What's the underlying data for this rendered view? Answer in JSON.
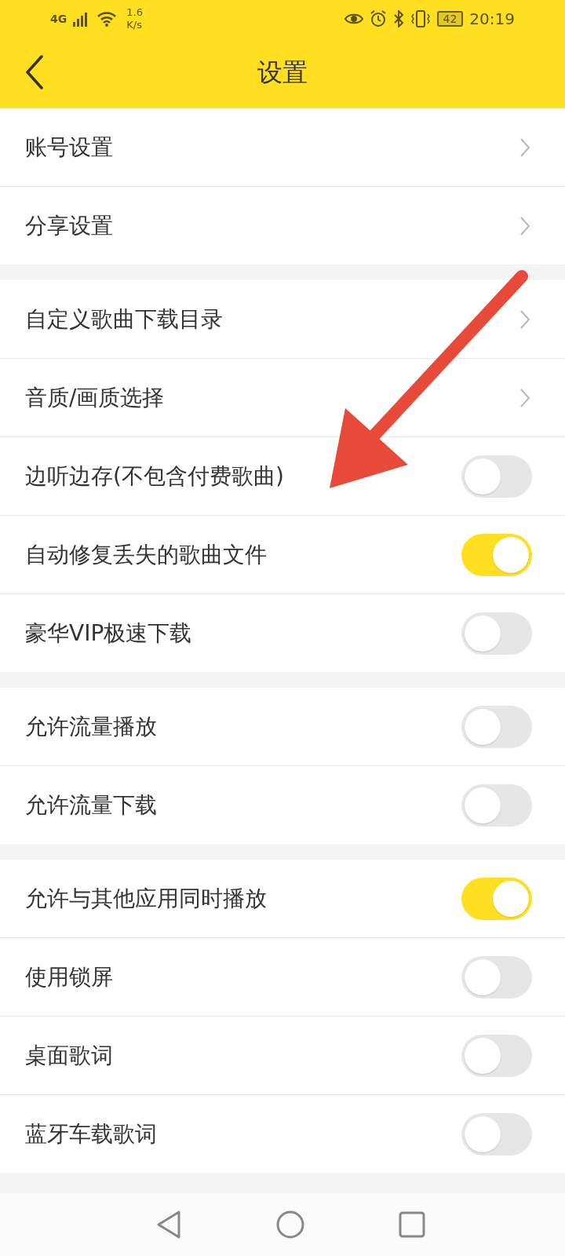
{
  "status_bar": {
    "network": "4G",
    "speed_value": "1.6",
    "speed_unit": "K/s",
    "battery": "42",
    "time": "20:19"
  },
  "header": {
    "title": "设置"
  },
  "sections": [
    {
      "items": [
        {
          "label": "账号设置",
          "kind": "link"
        },
        {
          "label": "分享设置",
          "kind": "link"
        }
      ]
    },
    {
      "items": [
        {
          "label": "自定义歌曲下载目录",
          "kind": "link"
        },
        {
          "label": "音质/画质选择",
          "kind": "link"
        },
        {
          "label": "边听边存(不包含付费歌曲)",
          "kind": "toggle",
          "on": false
        },
        {
          "label": "自动修复丢失的歌曲文件",
          "kind": "toggle",
          "on": true
        },
        {
          "label": "豪华VIP极速下载",
          "kind": "toggle",
          "on": false
        }
      ]
    },
    {
      "items": [
        {
          "label": "允许流量播放",
          "kind": "toggle",
          "on": false
        },
        {
          "label": "允许流量下载",
          "kind": "toggle",
          "on": false
        }
      ]
    },
    {
      "items": [
        {
          "label": "允许与其他应用同时播放",
          "kind": "toggle",
          "on": true
        },
        {
          "label": "使用锁屏",
          "kind": "toggle",
          "on": false
        },
        {
          "label": "桌面歌词",
          "kind": "toggle",
          "on": false
        },
        {
          "label": "蓝牙车载歌词",
          "kind": "toggle",
          "on": false
        }
      ]
    }
  ],
  "annotation": {
    "kind": "arrow"
  }
}
